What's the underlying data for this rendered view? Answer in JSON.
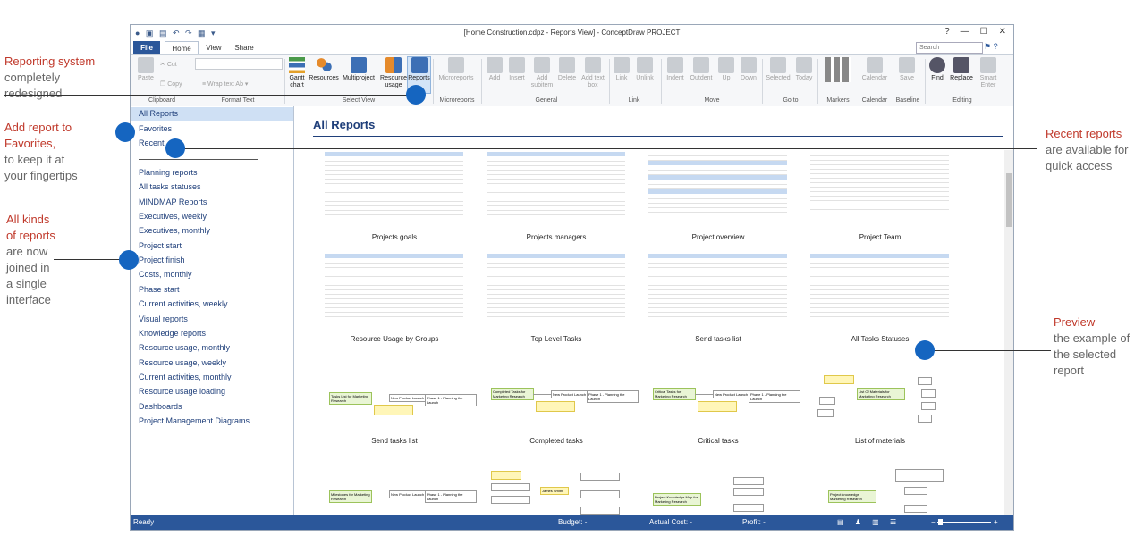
{
  "annotations": {
    "reporting": {
      "red": "Reporting system",
      "grey": [
        "completely",
        "redesigned"
      ]
    },
    "favorites": {
      "red": [
        "Add report to",
        "Favorites,"
      ],
      "grey": [
        "to keep it at",
        "your fingertips"
      ]
    },
    "allkinds": {
      "red": [
        "All kinds",
        "of reports"
      ],
      "grey": [
        "are now",
        "joined in",
        "a single",
        "interface"
      ]
    },
    "recent": {
      "red": "Recent reports",
      "grey": [
        "are available for",
        "quick access"
      ]
    },
    "preview": {
      "red": "Preview",
      "grey": [
        "the example of",
        "the selected",
        "report"
      ]
    }
  },
  "window": {
    "title": "[Home Construction.cdpz - Reports View] - ConceptDraw PROJECT"
  },
  "tabs": {
    "file": "File",
    "home": "Home",
    "view": "View",
    "share": "Share"
  },
  "search_placeholder": "Search",
  "ribbon": {
    "paste": "Paste",
    "cut": "Cut",
    "copy": "Copy",
    "wrap_text": "Wrap text",
    "clipboard": "Clipboard",
    "format_text": "Format Text",
    "gantt": "Gantt chart",
    "resources": "Resources",
    "multiproject": "Multiproject",
    "resource_usage": "Resource usage",
    "reports": "Reports",
    "select_view": "Select View",
    "microreports": "Microreports",
    "microreports_group": "Microreports",
    "add": "Add",
    "insert": "Insert",
    "add_subitem": "Add subitem",
    "delete": "Delete",
    "add_text_box": "Add text box",
    "general": "General",
    "link": "Link",
    "unlink": "Unlink",
    "link_group": "Link",
    "indent": "Indent",
    "outdent": "Outdent",
    "up": "Up",
    "down": "Down",
    "move": "Move",
    "selected": "Selected",
    "today": "Today",
    "goto": "Go to",
    "markers": "Markers",
    "calendar": "Calendar",
    "calendar_group": "Calendar",
    "save": "Save",
    "baseline": "Baseline",
    "find": "Find",
    "replace": "Replace",
    "smart_enter": "Smart Enter",
    "editing": "Editing"
  },
  "sidebar": {
    "top": [
      "All Reports",
      "Favorites",
      "Recent"
    ],
    "items": [
      "Planning reports",
      "All tasks statuses",
      "MINDMAP Reports",
      "Executives, weekly",
      "Executives, monthly",
      "Project start",
      "Project finish",
      "Costs, monthly",
      "Phase start",
      "Current activities, weekly",
      "Visual reports",
      "Knowledge reports",
      "Resource usage, monthly",
      "Resource usage, weekly",
      "Current activities, monthly",
      "Resource usage loading",
      "Dashboards",
      "Project Management Diagrams"
    ]
  },
  "main": {
    "title": "All Reports",
    "row1": [
      "Projects goals",
      "Projects managers",
      "Project overview",
      "Project Team"
    ],
    "row2": [
      "Resource Usage by Groups",
      "Top Level Tasks",
      "Send tasks list",
      "All Tasks Statuses"
    ],
    "row3": [
      "Send tasks list",
      "Completed tasks",
      "Critical tasks",
      "List of materials"
    ]
  },
  "mindmap": {
    "nodes": [
      "Tasks List for Marketing Research",
      "Completed Tasks for Marketing Research",
      "Critical Tasks for Marketing Research",
      "List Of Materials for Marketing Research",
      "Milestones for Marketing Research",
      "James Smith",
      "Project Knowledge Map for Marketing Research",
      "Project knowledge Marketing Research"
    ],
    "phase": "New Product Launch",
    "phase1": "Phase 1 - Planning the Launch"
  },
  "status": {
    "ready": "Ready",
    "budget": "Budget: -",
    "actual": "Actual Cost: -",
    "profit": "Profit: -"
  }
}
